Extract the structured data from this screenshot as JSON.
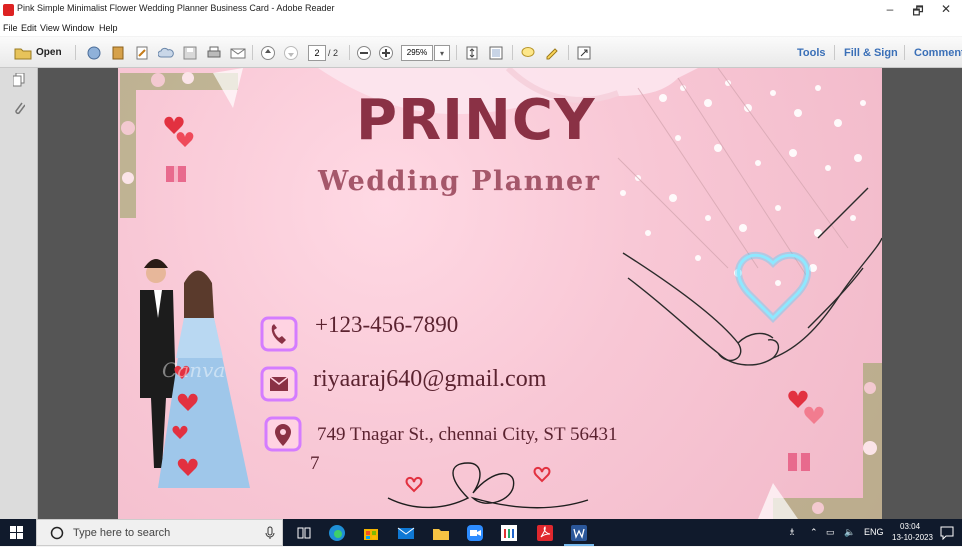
{
  "window": {
    "title": "Pink Simple Minimalist Flower Wedding Planner Business Card - Adobe Reader",
    "controls": [
      "–",
      "🗗",
      "✕"
    ]
  },
  "menu": [
    "File",
    "Edit",
    "View",
    "Window",
    "Help"
  ],
  "toolbar": {
    "open_label": "Open",
    "page_current": "2",
    "page_total": "/ 2",
    "zoom": "295%",
    "tools_label": "Tools",
    "fill_sign_label": "Fill & Sign",
    "comment_label": "Comment"
  },
  "card": {
    "name": "PRINCY",
    "role": "Wedding Planner",
    "phone": "+123-456-7890",
    "email": "riyaaraj640@gmail.com",
    "address_line1": "749 Tnagar St., chennai City, ST 56431",
    "address_line2": "7",
    "watermark": "Canva"
  },
  "taskbar": {
    "search_placeholder": "Type here to search",
    "tray_lang": "ENG",
    "time": "03:04",
    "date": "13-10-2023"
  },
  "colors": {
    "brand_text": "#8a3145",
    "accent_pink": "#f4b9c8",
    "heart_red": "#e23140",
    "neon_blue": "#3fd0ff",
    "taskbar": "#101a2c"
  }
}
